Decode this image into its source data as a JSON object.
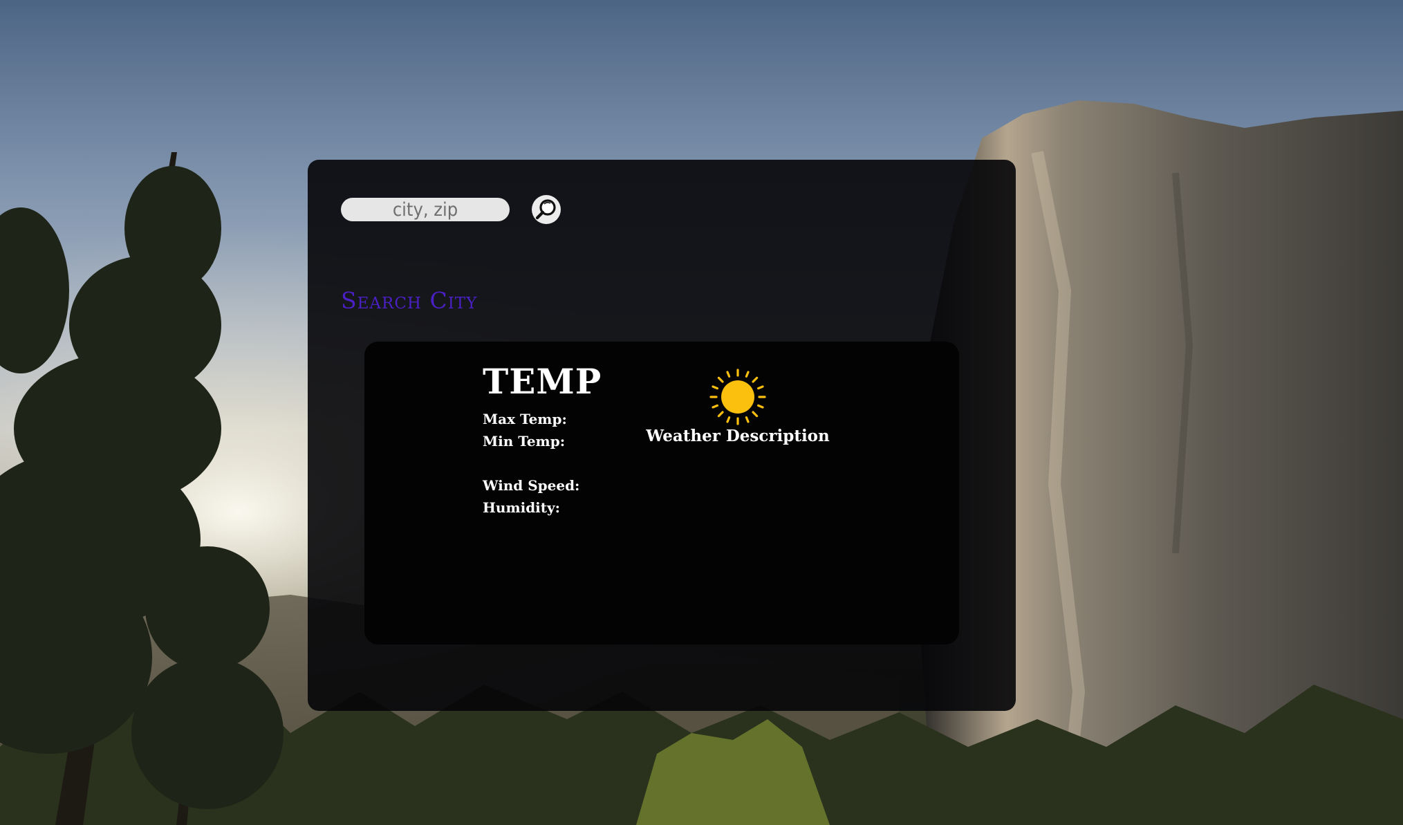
{
  "search": {
    "placeholder": "city, zip",
    "button_icon": "search-icon"
  },
  "section_title": "Search City",
  "weather": {
    "temp_label": "TEMP",
    "max_temp_label": "Max Temp:",
    "min_temp_label": "Min Temp:",
    "wind_speed_label": "Wind Speed:",
    "humidity_label": "Humidity:",
    "icon": "sun-icon",
    "description": "Weather Description"
  },
  "colors": {
    "title_accent": "#4a1fc4",
    "sun": "#fbbf0e",
    "panel": "#060609",
    "card": "#030303"
  }
}
